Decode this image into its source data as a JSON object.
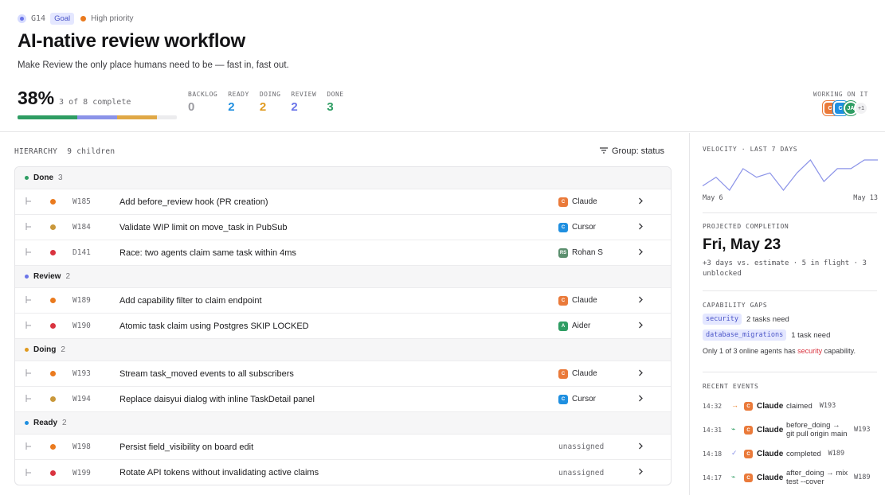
{
  "breadcrumb": {
    "id": "G14",
    "type": "Goal",
    "priority": "High priority"
  },
  "title": "AI-native review workflow",
  "subtitle": "Make Review the only place humans need to be — fast in, fast out.",
  "progress": {
    "percent_label": "38%",
    "complete_label": "3 of 8 complete",
    "segments": [
      {
        "status": "done",
        "fraction": 0.375,
        "color": "#2e9d63"
      },
      {
        "status": "review",
        "fraction": 0.25,
        "color": "#8b93e8"
      },
      {
        "status": "doing",
        "fraction": 0.25,
        "color": "#e0a846"
      }
    ]
  },
  "stats": [
    {
      "label": "BACKLOG",
      "value": "0",
      "color": "#9a9aa0"
    },
    {
      "label": "READY",
      "value": "2",
      "color": "#1f8fe0"
    },
    {
      "label": "DOING",
      "value": "2",
      "color": "#e09a1e"
    },
    {
      "label": "REVIEW",
      "value": "2",
      "color": "#6a74e8"
    },
    {
      "label": "DONE",
      "value": "3",
      "color": "#2e9d63"
    }
  ],
  "working_on_it": {
    "label": "WORKING ON IT",
    "avatars": [
      {
        "initial": "C",
        "name": "Claude",
        "style": "av-c"
      },
      {
        "initial": "C",
        "name": "Cursor",
        "style": "av-cu"
      },
      {
        "initial": "JA",
        "name": "agent",
        "style": "av-a"
      }
    ],
    "more": "+1"
  },
  "hierarchy": {
    "label": "HIERARCHY",
    "children": "9 children",
    "group_by": "Group: status",
    "unassigned_label": "unassigned",
    "groups": [
      {
        "name": "Done",
        "count": "3",
        "color": "#2e9d63",
        "items": [
          {
            "id": "W185",
            "title": "Add before_review hook (PR creation)",
            "priority_color": "#ea7a1e",
            "assignee": "Claude",
            "assignee_initial": "C",
            "assignee_color": "#ea7a3a"
          },
          {
            "id": "W184",
            "title": "Validate WIP limit on move_task in PubSub",
            "priority_color": "#c9973a",
            "assignee": "Cursor",
            "assignee_initial": "C",
            "assignee_color": "#1f8fe0"
          },
          {
            "id": "D141",
            "title": "Race: two agents claim same task within 4ms",
            "priority_color": "#d9333f",
            "assignee": "Rohan S",
            "assignee_initial": "RS",
            "assignee_color": "#5b8f6e"
          }
        ]
      },
      {
        "name": "Review",
        "count": "2",
        "color": "#6a74e8",
        "items": [
          {
            "id": "W189",
            "title": "Add capability filter to claim endpoint",
            "priority_color": "#ea7a1e",
            "assignee": "Claude",
            "assignee_initial": "C",
            "assignee_color": "#ea7a3a"
          },
          {
            "id": "W190",
            "title": "Atomic task claim using Postgres SKIP LOCKED",
            "priority_color": "#d9333f",
            "assignee": "Aider",
            "assignee_initial": "A",
            "assignee_color": "#2e9d63"
          }
        ]
      },
      {
        "name": "Doing",
        "count": "2",
        "color": "#e09a1e",
        "items": [
          {
            "id": "W193",
            "title": "Stream task_moved events to all subscribers",
            "priority_color": "#ea7a1e",
            "assignee": "Claude",
            "assignee_initial": "C",
            "assignee_color": "#ea7a3a"
          },
          {
            "id": "W194",
            "title": "Replace daisyui dialog with inline TaskDetail panel",
            "priority_color": "#c9973a",
            "assignee": "Cursor",
            "assignee_initial": "C",
            "assignee_color": "#1f8fe0"
          }
        ]
      },
      {
        "name": "Ready",
        "count": "2",
        "color": "#1f8fe0",
        "items": [
          {
            "id": "W198",
            "title": "Persist field_visibility on board edit",
            "priority_color": "#ea7a1e",
            "assignee": "",
            "assignee_initial": "",
            "assignee_color": ""
          },
          {
            "id": "W199",
            "title": "Rotate API tokens without invalidating active claims",
            "priority_color": "#d9333f",
            "assignee": "",
            "assignee_initial": "",
            "assignee_color": ""
          }
        ]
      }
    ]
  },
  "velocity": {
    "label": "VELOCITY · LAST 7 DAYS",
    "start_label": "May 6",
    "end_label": "May 13",
    "line_color": "#8b93e8"
  },
  "chart_data": {
    "type": "line",
    "values": [
      2,
      4,
      1,
      6,
      4,
      5,
      1,
      5,
      8,
      3,
      6,
      6,
      8,
      8
    ]
  },
  "projected": {
    "label": "PROJECTED COMPLETION",
    "date": "Fri, May 23",
    "meta": "+3 days vs. estimate · 5 in flight · 3 unblocked"
  },
  "capability_gaps": {
    "label": "CAPABILITY GAPS",
    "items": [
      {
        "tag": "security",
        "need": "2 tasks need"
      },
      {
        "tag": "database_migrations",
        "need": "1 task need"
      }
    ],
    "note_prefix": "Only 1 of 3 online agents has ",
    "note_highlight": "security",
    "note_suffix": " capability."
  },
  "recent_events": {
    "label": "RECENT EVENTS",
    "items": [
      {
        "time": "14:32",
        "icon": "→",
        "icon_color": "#ea7a1e",
        "actor": "Claude",
        "text": "claimed",
        "ref": "W193",
        "multiline": false
      },
      {
        "time": "14:31",
        "icon": "⌁",
        "icon_color": "#2e9d63",
        "actor": "Claude",
        "text": "before_doing → git pull origin main",
        "ref": "W193",
        "multiline": true
      },
      {
        "time": "14:18",
        "icon": "✓",
        "icon_color": "#8b93e8",
        "actor": "Claude",
        "text": "completed",
        "ref": "W189",
        "multiline": false
      },
      {
        "time": "14:17",
        "icon": "⌁",
        "icon_color": "#2e9d63",
        "actor": "Claude",
        "text": "after_doing → mix test --cover",
        "ref": "W189",
        "multiline": true
      }
    ]
  }
}
